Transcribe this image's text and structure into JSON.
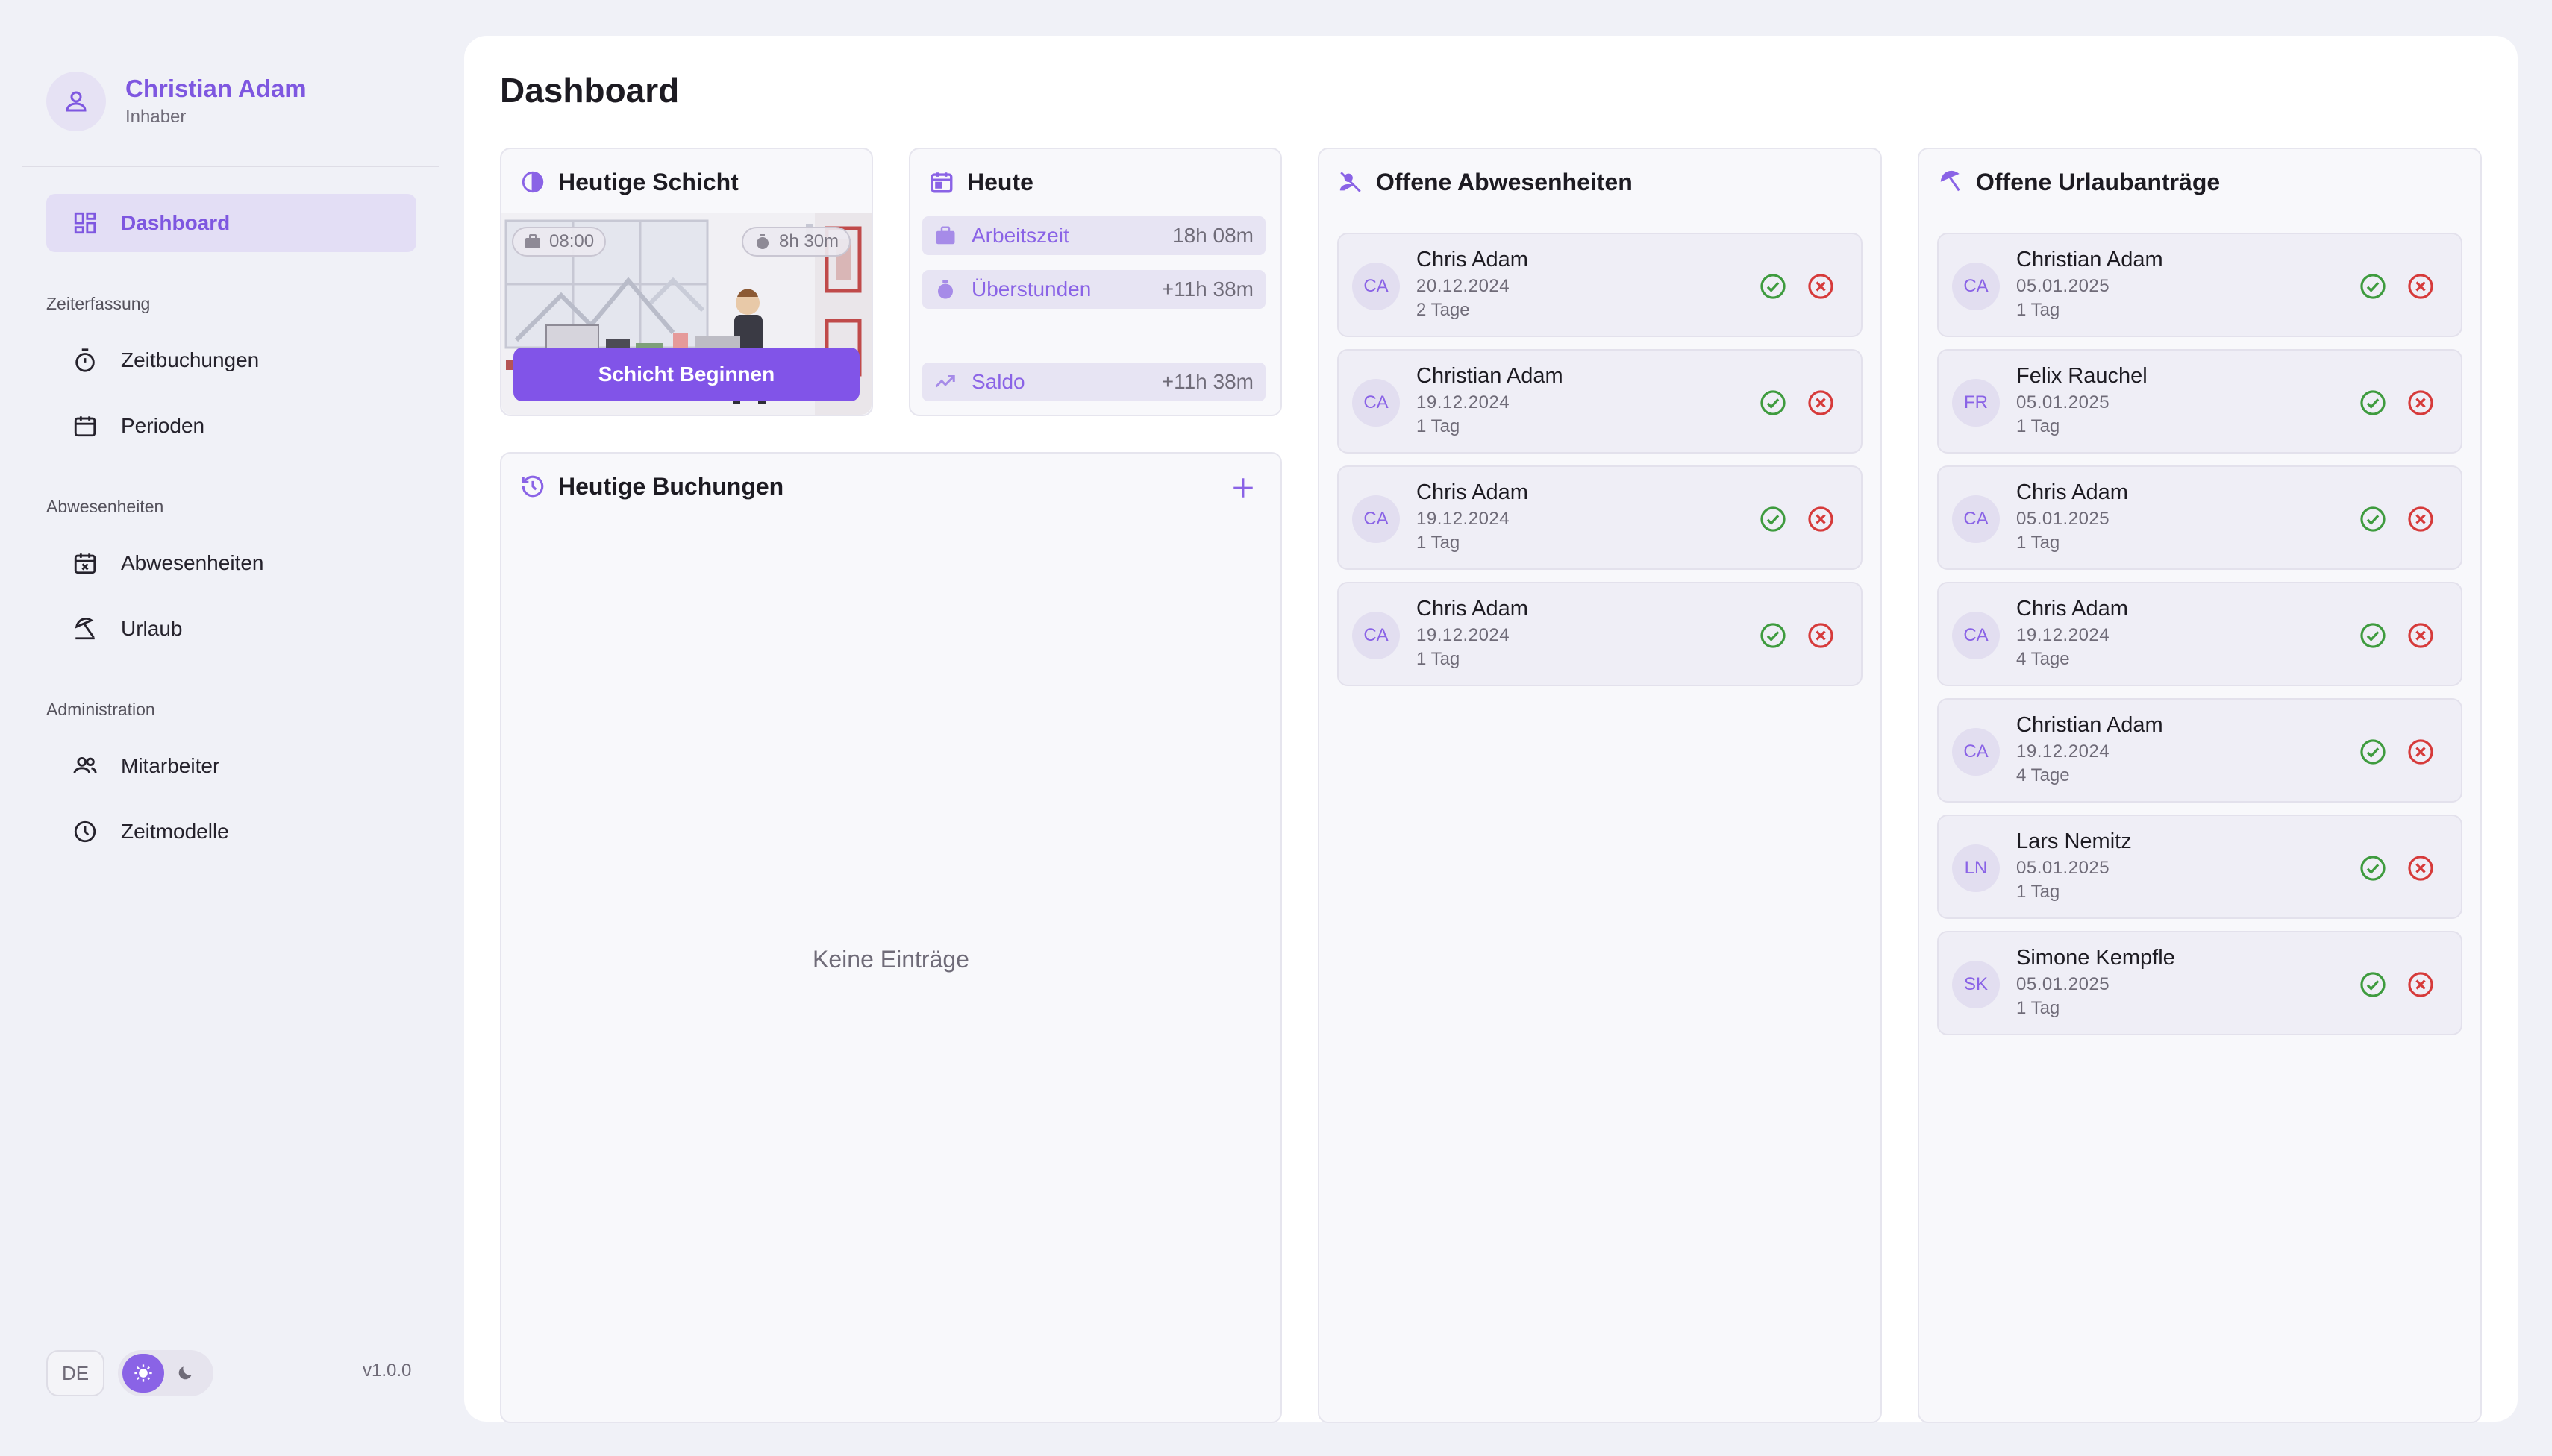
{
  "user": {
    "name": "Christian Adam",
    "role": "Inhaber"
  },
  "nav": {
    "dashboard": "Dashboard",
    "sections": {
      "time": "Zeiterfassung",
      "absence": "Abwesenheiten",
      "admin": "Administration"
    },
    "items": {
      "bookings": "Zeitbuchungen",
      "periods": "Perioden",
      "absences": "Abwesenheiten",
      "vacation": "Urlaub",
      "employees": "Mitarbeiter",
      "timemodels": "Zeitmodelle"
    }
  },
  "footer": {
    "lang": "DE",
    "version": "v1.0.0"
  },
  "page": {
    "title": "Dashboard"
  },
  "shift": {
    "title": "Heutige Schicht",
    "start_time": "08:00",
    "duration": "8h 30m",
    "button": "Schicht Beginnen"
  },
  "today": {
    "title": "Heute",
    "work": {
      "label": "Arbeitszeit",
      "value": "18h 08m"
    },
    "overtime": {
      "label": "Überstunden",
      "value": "+11h 38m"
    },
    "balance": {
      "label": "Saldo",
      "value": "+11h 38m"
    }
  },
  "bookings": {
    "title": "Heutige Buchungen",
    "empty": "Keine Einträge"
  },
  "absences": {
    "title": "Offene Abwesenheiten",
    "items": [
      {
        "initials": "CA",
        "name": "Chris Adam",
        "date": "20.12.2024",
        "duration": "2 Tage"
      },
      {
        "initials": "CA",
        "name": "Christian Adam",
        "date": "19.12.2024",
        "duration": "1 Tag"
      },
      {
        "initials": "CA",
        "name": "Chris Adam",
        "date": "19.12.2024",
        "duration": "1 Tag"
      },
      {
        "initials": "CA",
        "name": "Chris Adam",
        "date": "19.12.2024",
        "duration": "1 Tag"
      }
    ]
  },
  "vacations": {
    "title": "Offene Urlaubanträge",
    "items": [
      {
        "initials": "CA",
        "name": "Christian Adam",
        "date": "05.01.2025",
        "duration": "1 Tag"
      },
      {
        "initials": "FR",
        "name": "Felix Rauchel",
        "date": "05.01.2025",
        "duration": "1 Tag"
      },
      {
        "initials": "CA",
        "name": "Chris Adam",
        "date": "05.01.2025",
        "duration": "1 Tag"
      },
      {
        "initials": "CA",
        "name": "Chris Adam",
        "date": "19.12.2024",
        "duration": "4 Tage"
      },
      {
        "initials": "CA",
        "name": "Christian Adam",
        "date": "19.12.2024",
        "duration": "4 Tage"
      },
      {
        "initials": "LN",
        "name": "Lars Nemitz",
        "date": "05.01.2025",
        "duration": "1 Tag"
      },
      {
        "initials": "SK",
        "name": "Simone Kempfle",
        "date": "05.01.2025",
        "duration": "1 Tag"
      }
    ]
  },
  "colors": {
    "accent": "#8154e8",
    "approve": "#3e9b3e",
    "reject": "#d63a3a"
  }
}
